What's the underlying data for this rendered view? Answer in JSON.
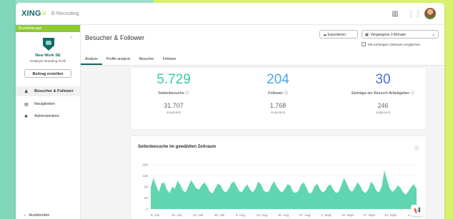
{
  "app": {
    "logo": "XING",
    "logo_sub": "E-Recruiting"
  },
  "topbar": {
    "icons": [
      "chart-icon",
      "grid-icon",
      "avatar"
    ]
  },
  "sidebar": {
    "brand_tab": "BrandManager",
    "company_name": "New Work SE",
    "company_sub": "Employer Branding Profil",
    "create_post": "Beitrag erstellen",
    "items": [
      {
        "label": "Besucher & Follower",
        "icon": "people-icon",
        "active": true
      },
      {
        "label": "Neuigkeiten",
        "icon": "news-icon",
        "active": false
      },
      {
        "label": "Administration",
        "icon": "gear-icon",
        "active": false
      }
    ],
    "collapse": "Ausblenden"
  },
  "header": {
    "title": "Besucher & Follower",
    "export": "Exportieren",
    "period": "Vergangene 3 Monate",
    "compare": "Mit vorherigem Zeitraum vergleichen",
    "tabs": [
      "Analyse",
      "Profile analysis",
      "Besucher",
      "Follower"
    ]
  },
  "kpis": [
    {
      "value": "5.729",
      "label": "Seitenbesuche",
      "total": "31.707",
      "total_label": "insgesamt",
      "color": "#2fcf9c"
    },
    {
      "value": "204",
      "label": "Follower",
      "total": "1.768",
      "total_label": "insgesamt",
      "color": "#4aa8e8"
    },
    {
      "value": "30",
      "label": "Einträge als Wunsch-Arbeitgeber",
      "total": "246",
      "total_label": "insgesamt",
      "color": "#4a6ee0"
    }
  ],
  "chart_data": {
    "type": "area",
    "title": "Seitenbesuche im gewählten Zeitraum",
    "y_ticks": [
      0,
      40,
      80,
      120,
      160
    ],
    "ylim": [
      0,
      160
    ],
    "x_ticks": [
      "9. Juli",
      "16. Juli",
      "23. Juli",
      "30. Juli",
      "6. Aug.",
      "13. Aug.",
      "20. Aug.",
      "27. Aug.",
      "3. Sept.",
      "10. Sept.",
      "17. Sept.",
      "24. Sept.",
      "1. Okt."
    ],
    "color": "#5fd6b0",
    "values": [
      78,
      112,
      84,
      62,
      92,
      96,
      70,
      58,
      80,
      74,
      102,
      88,
      66,
      60,
      82,
      104,
      90,
      74,
      70,
      86,
      96,
      82,
      62,
      56,
      74,
      92,
      86,
      66,
      60,
      72,
      92,
      100,
      82,
      64,
      62,
      78,
      88,
      70,
      60,
      74,
      98,
      90,
      68,
      60,
      64,
      86,
      100,
      80,
      66,
      60,
      74,
      90,
      84,
      62,
      58,
      66,
      88,
      96,
      76,
      56,
      60,
      82,
      92,
      72,
      60,
      66,
      84,
      88,
      70,
      58,
      62,
      86,
      112,
      92,
      70,
      62,
      78,
      96,
      84,
      64,
      58,
      70,
      98,
      88,
      66,
      60,
      80,
      140,
      104,
      74,
      62,
      70,
      86,
      76,
      60,
      52,
      64,
      80,
      90,
      72
    ]
  },
  "feedback_icon": "megaphone-icon"
}
